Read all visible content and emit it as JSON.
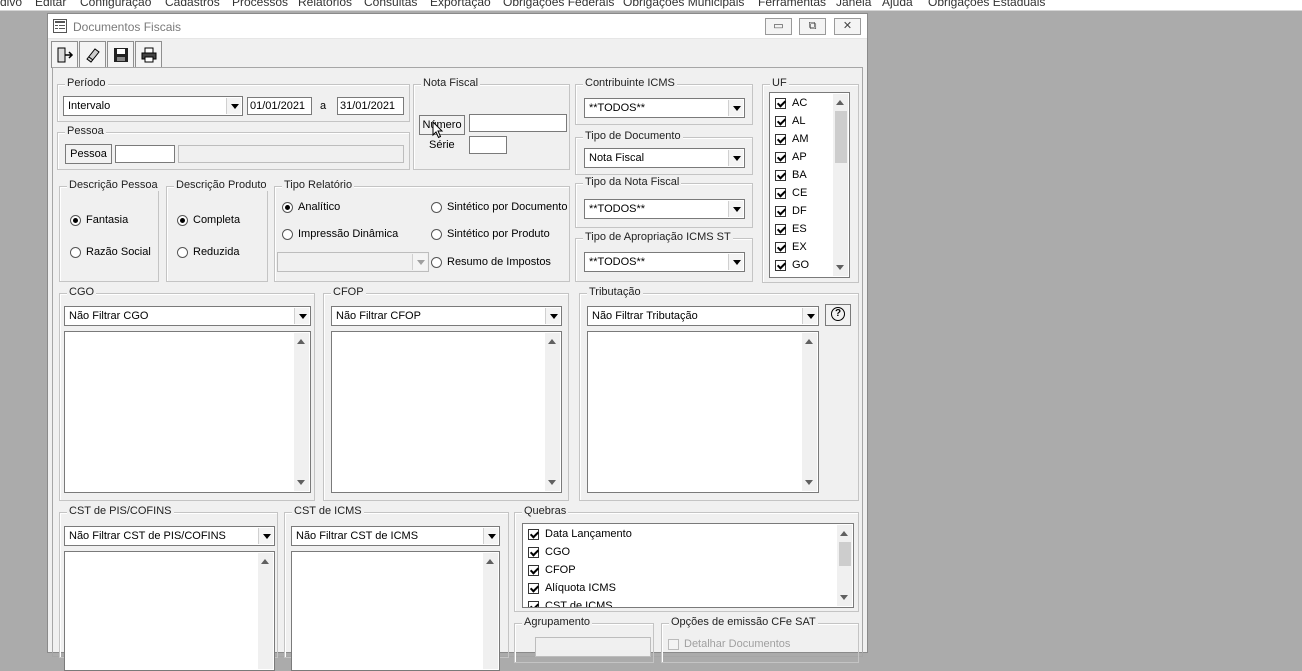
{
  "menu": [
    "divo",
    "Editar",
    "Configuração",
    "Cadastros",
    "Processos",
    "Relatórios",
    "Consultas",
    "Exportação",
    "Obrigações Federais",
    "Obrigações Municipais",
    "Ferramentas",
    "Janela",
    "Ajuda",
    "Obrigações Estaduais"
  ],
  "window": {
    "title": "Documentos Fiscais",
    "minimize_glyph": "▭",
    "restore_glyph": "⧉",
    "close_glyph": "✕"
  },
  "periodo": {
    "label": "Período",
    "tipo": "Intervalo",
    "data_inicio": "01/01/2021",
    "separator": "a",
    "data_fim": "31/01/2021"
  },
  "pessoa": {
    "label": "Pessoa",
    "button": "Pessoa",
    "codigo": "",
    "nome": ""
  },
  "nota_fiscal": {
    "label": "Nota Fiscal",
    "numero_button": "Número",
    "numero_value": "",
    "serie_label": "Série",
    "serie_value": ""
  },
  "contribuinte": {
    "label": "Contribuinte ICMS",
    "value": "**TODOS**"
  },
  "tipo_documento": {
    "label": "Tipo de Documento",
    "value": "Nota Fiscal"
  },
  "tipo_nota": {
    "label": "Tipo da Nota Fiscal",
    "value": "**TODOS**"
  },
  "tipo_apropriacao": {
    "label": "Tipo de Apropriação ICMS ST",
    "value": "**TODOS**"
  },
  "uf": {
    "label": "UF",
    "items": [
      "AC",
      "AL",
      "AM",
      "AP",
      "BA",
      "CE",
      "DF",
      "ES",
      "EX",
      "GO"
    ]
  },
  "descricao_pessoa": {
    "label": "Descrição Pessoa",
    "options": [
      "Fantasia",
      "Razão Social"
    ],
    "selected": "Fantasia"
  },
  "descricao_produto": {
    "label": "Descrição Produto",
    "options": [
      "Completa",
      "Reduzida"
    ],
    "selected": "Completa"
  },
  "tipo_relatorio": {
    "label": "Tipo Relatório",
    "options": [
      "Analítico",
      "Sintético por Documento",
      "Impressão Dinâmica",
      "Sintético por Produto",
      "Resumo de Impostos"
    ],
    "selected": "Analítico",
    "combo_value": ""
  },
  "cgo": {
    "label": "CGO",
    "value": "Não Filtrar CGO"
  },
  "cfop": {
    "label": "CFOP",
    "value": "Não Filtrar CFOP"
  },
  "tributacao": {
    "label": "Tributação",
    "value": "Não Filtrar Tributação",
    "help_glyph": "?"
  },
  "cst_pis": {
    "label": "CST de PIS/COFINS",
    "value": "Não Filtrar CST de PIS/COFINS"
  },
  "cst_icms": {
    "label": "CST de ICMS",
    "value": "Não Filtrar CST de ICMS"
  },
  "quebras": {
    "label": "Quebras",
    "items": [
      "Data Lançamento",
      "CGO",
      "CFOP",
      "Alíquota ICMS",
      "CST de ICMS"
    ]
  },
  "agrupamento": {
    "label": "Agrupamento"
  },
  "opcoes_cfe": {
    "label": "Opções de emissão CFe SAT",
    "item": "Detalhar Documentos"
  }
}
